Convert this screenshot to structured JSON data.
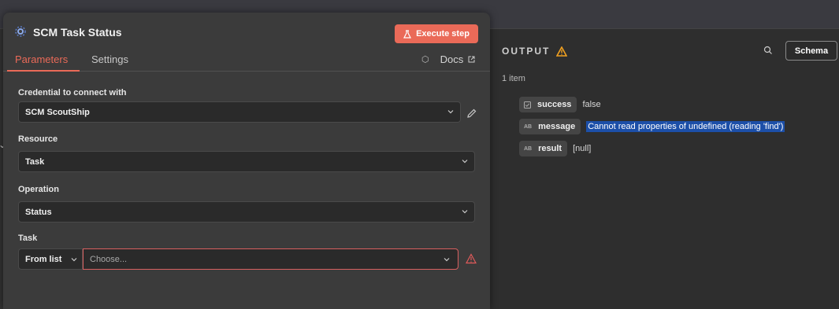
{
  "node": {
    "title": "SCM Task Status",
    "execute_label": "Execute step",
    "tabs": [
      {
        "label": "Parameters",
        "active": true
      },
      {
        "label": "Settings",
        "active": false
      }
    ],
    "docs_label": "Docs"
  },
  "fields": {
    "credential": {
      "label": "Credential to connect with",
      "value": "SCM ScoutShip"
    },
    "resource": {
      "label": "Resource",
      "value": "Task"
    },
    "operation": {
      "label": "Operation",
      "value": "Status"
    },
    "task": {
      "label": "Task",
      "mode": "From list",
      "placeholder": "Choose..."
    }
  },
  "output": {
    "title": "OUTPUT",
    "view_mode": "Schema",
    "item_count": "1 item",
    "rows": [
      {
        "type_icon": "boolean-icon",
        "key": "success",
        "value": "false"
      },
      {
        "type_icon": "string-icon",
        "type_text": "AB",
        "key": "message",
        "value": "Cannot read properties of undefined (reading 'find')"
      },
      {
        "type_icon": "string-icon",
        "type_text": "AB",
        "key": "result",
        "value": "[null]"
      }
    ]
  },
  "colors": {
    "accent": "#ea6a58",
    "warning": "#f0a020",
    "error_border": "#d86060",
    "selection": "#1c4fa8"
  }
}
